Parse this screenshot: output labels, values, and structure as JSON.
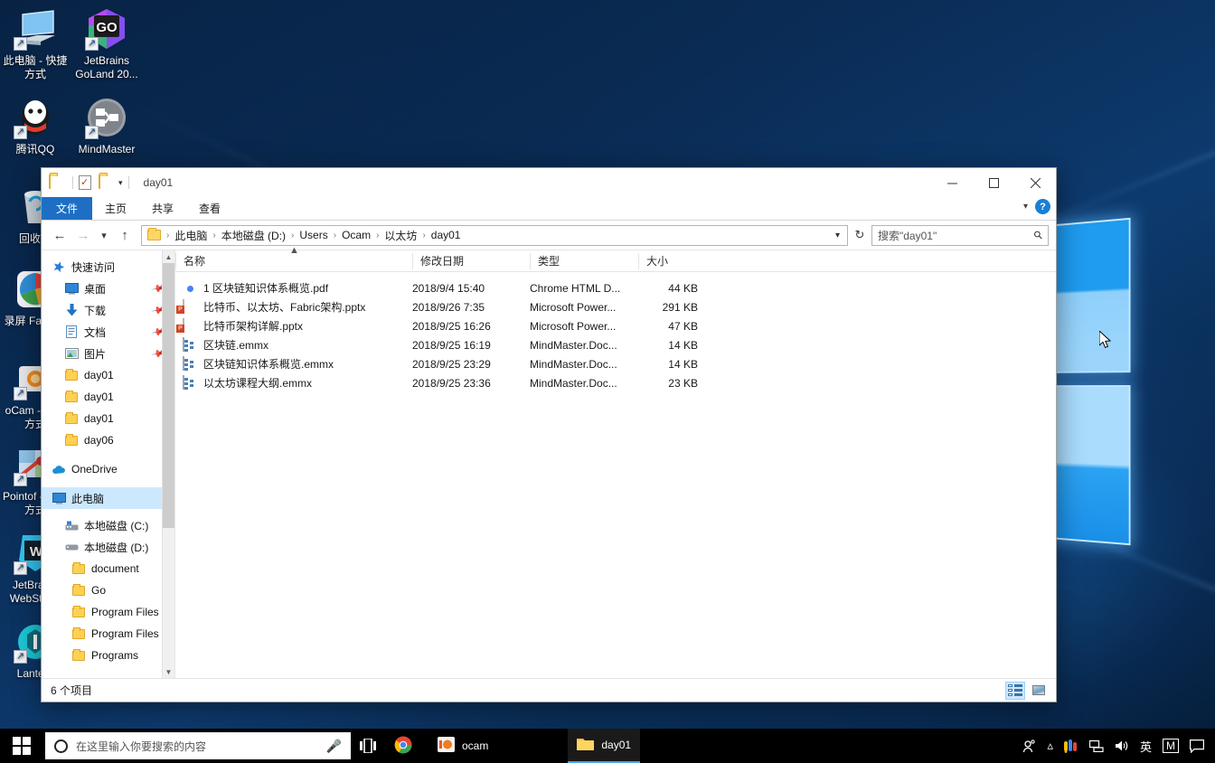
{
  "desktop": {
    "icons": [
      {
        "label": "此电脑 - 快捷方式",
        "icon": "computer-icon"
      },
      {
        "label": "JetBrains GoLand 20...",
        "icon": "goland-icon"
      },
      {
        "label": "腾讯QQ",
        "icon": "qq-icon"
      },
      {
        "label": "MindMaster",
        "icon": "mindmaster-icon"
      },
      {
        "label": "回收站",
        "icon": "recycle-bin-icon"
      },
      {
        "label": "录屏 FastS...",
        "icon": "fastStone-icon"
      },
      {
        "label": "oCam - 快捷方式",
        "icon": "ocam-icon"
      },
      {
        "label": "Pointof - 快捷方式",
        "icon": "pointofix-icon"
      },
      {
        "label": "JetBrains WebStorm",
        "icon": "webstorm-icon"
      },
      {
        "label": "Lantern",
        "icon": "lantern-icon"
      }
    ]
  },
  "window": {
    "title": "day01",
    "quick_access": {
      "folder_icon": "folder-icon",
      "properties_icon": "properties-icon",
      "new_folder_icon": "new-folder-icon",
      "dropdown_icon": "chevron-down-icon"
    },
    "controls": {
      "minimize": "—",
      "maximize": "☐",
      "close": "✕"
    },
    "ribbon_tabs": [
      {
        "label": "文件",
        "active": true
      },
      {
        "label": "主页",
        "active": false
      },
      {
        "label": "共享",
        "active": false
      },
      {
        "label": "查看",
        "active": false
      }
    ],
    "ribbon_right": {
      "collapse_icon": "chevron-down-icon",
      "help_label": "?"
    },
    "nav": {
      "back_icon": "arrow-left-icon",
      "forward_icon": "arrow-right-icon",
      "recent_icon": "chevron-down-icon",
      "up_icon": "arrow-up-icon",
      "refresh_icon": "refresh-icon",
      "address_dropdown_icon": "chevron-down-icon",
      "breadcrumbs": [
        "此电脑",
        "本地磁盘 (D:)",
        "Users",
        "Ocam",
        "以太坊",
        "day01"
      ],
      "breadcrumb_separator": "›"
    },
    "search": {
      "placeholder": "搜索\"day01\"",
      "value": "",
      "icon": "search-icon"
    },
    "sidebar": {
      "items": [
        {
          "label": "快速访问",
          "icon": "star-icon",
          "indent": 0,
          "pinned": false,
          "selected": false
        },
        {
          "label": "桌面",
          "icon": "desktop-icon",
          "indent": 1,
          "pinned": true,
          "selected": false
        },
        {
          "label": "下载",
          "icon": "download-icon",
          "indent": 1,
          "pinned": true,
          "selected": false
        },
        {
          "label": "文档",
          "icon": "documents-icon",
          "indent": 1,
          "pinned": true,
          "selected": false
        },
        {
          "label": "图片",
          "icon": "pictures-icon",
          "indent": 1,
          "pinned": true,
          "selected": false
        },
        {
          "label": "day01",
          "icon": "folder-icon",
          "indent": 1,
          "pinned": false,
          "selected": false
        },
        {
          "label": "day01",
          "icon": "folder-icon",
          "indent": 1,
          "pinned": false,
          "selected": false
        },
        {
          "label": "day01",
          "icon": "folder-icon",
          "indent": 1,
          "pinned": false,
          "selected": false
        },
        {
          "label": "day06",
          "icon": "folder-icon",
          "indent": 1,
          "pinned": false,
          "selected": false
        },
        {
          "label": "OneDrive",
          "icon": "onedrive-icon",
          "indent": 0,
          "pinned": false,
          "selected": false
        },
        {
          "label": "此电脑",
          "icon": "computer-icon",
          "indent": 0,
          "pinned": false,
          "selected": true
        },
        {
          "label": "本地磁盘 (C:)",
          "icon": "drive-windows-icon",
          "indent": 1,
          "pinned": false,
          "selected": false
        },
        {
          "label": "本地磁盘 (D:)",
          "icon": "drive-icon",
          "indent": 1,
          "pinned": false,
          "selected": false
        },
        {
          "label": "document",
          "icon": "folder-icon",
          "indent": 2,
          "pinned": false,
          "selected": false
        },
        {
          "label": "Go",
          "icon": "folder-icon",
          "indent": 2,
          "pinned": false,
          "selected": false
        },
        {
          "label": "Program Files",
          "icon": "folder-icon",
          "indent": 2,
          "pinned": false,
          "selected": false
        },
        {
          "label": "Program Files (",
          "icon": "folder-icon",
          "indent": 2,
          "pinned": false,
          "selected": false
        },
        {
          "label": "Programs",
          "icon": "folder-icon",
          "indent": 2,
          "pinned": false,
          "selected": false
        }
      ],
      "scroll_up_icon": "chevron-up-icon",
      "scroll_down_icon": "chevron-down-icon"
    },
    "columns": [
      {
        "key": "name",
        "label": "名称",
        "sorted": "asc"
      },
      {
        "key": "date",
        "label": "修改日期",
        "sorted": ""
      },
      {
        "key": "type",
        "label": "类型",
        "sorted": ""
      },
      {
        "key": "size",
        "label": "大小",
        "sorted": ""
      }
    ],
    "files": [
      {
        "name": "1 区块链知识体系概览.pdf",
        "date": "2018/9/4 15:40",
        "type": "Chrome HTML D...",
        "size": "44 KB",
        "icon": "chrome-html-icon"
      },
      {
        "name": "比特币、以太坊、Fabric架构.pptx",
        "date": "2018/9/26 7:35",
        "type": "Microsoft Power...",
        "size": "291 KB",
        "icon": "powerpoint-icon"
      },
      {
        "name": "比特币架构详解.pptx",
        "date": "2018/9/25 16:26",
        "type": "Microsoft Power...",
        "size": "47 KB",
        "icon": "powerpoint-icon"
      },
      {
        "name": "区块链.emmx",
        "date": "2018/9/25 16:19",
        "type": "MindMaster.Doc...",
        "size": "14 KB",
        "icon": "mindmaster-file-icon"
      },
      {
        "name": "区块链知识体系概览.emmx",
        "date": "2018/9/25 23:29",
        "type": "MindMaster.Doc...",
        "size": "14 KB",
        "icon": "mindmaster-file-icon"
      },
      {
        "name": "以太坊课程大纲.emmx",
        "date": "2018/9/25 23:36",
        "type": "MindMaster.Doc...",
        "size": "23 KB",
        "icon": "mindmaster-file-icon"
      }
    ],
    "status": {
      "item_count": "6 个项目",
      "details_view_icon": "details-view-icon",
      "thumbnail_view_icon": "thumbnail-view-icon"
    }
  },
  "taskbar": {
    "start_icon": "windows-start-icon",
    "search": {
      "placeholder": "在这里输入你要搜索的内容",
      "circle_icon": "cortana-circle-icon",
      "mic_icon": "microphone-icon"
    },
    "task_view_icon": "task-view-icon",
    "buttons": [
      {
        "label": "",
        "icon": "chrome-icon",
        "active": false
      },
      {
        "label": "ocam",
        "icon": "ocam-icon",
        "active": false
      },
      {
        "label": "day01",
        "icon": "folder-icon",
        "active": true
      }
    ],
    "tray": [
      {
        "name": "people-icon",
        "glyph": "\u0001"
      },
      {
        "name": "show-hidden-icons-chevron",
        "glyph": "∧"
      },
      {
        "name": "google-ime-icon",
        "glyph": ""
      },
      {
        "name": "network-icon",
        "glyph": ""
      },
      {
        "name": "volume-icon",
        "glyph": ""
      },
      {
        "name": "input-language-icon",
        "glyph": "英"
      },
      {
        "name": "mindmaster-tray-icon",
        "glyph": "M"
      },
      {
        "name": "action-center-icon",
        "glyph": ""
      }
    ]
  }
}
